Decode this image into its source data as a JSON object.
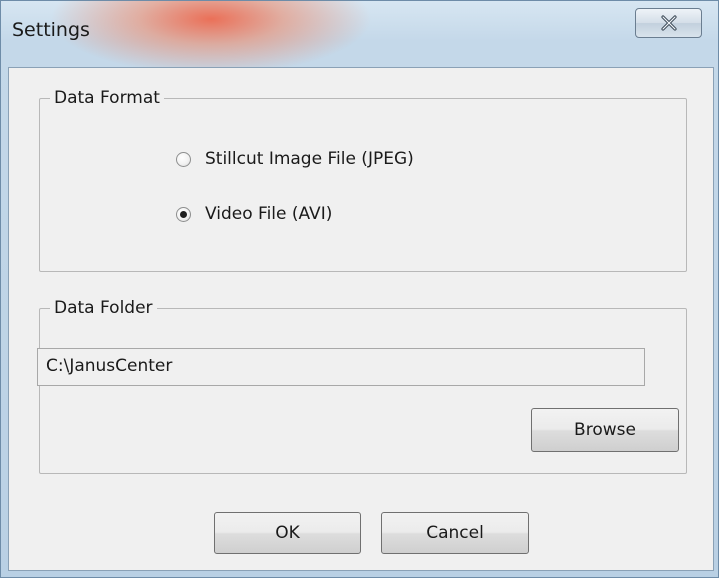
{
  "window": {
    "title": "Settings"
  },
  "data_format": {
    "label": "Data Format",
    "options": [
      {
        "label": "Stillcut Image File (JPEG)",
        "checked": false
      },
      {
        "label": "Video File (AVI)",
        "checked": true
      }
    ]
  },
  "data_folder": {
    "label": "Data Folder",
    "path_value": "C:\\JanusCenter",
    "browse_label": "Browse"
  },
  "footer": {
    "ok_label": "OK",
    "cancel_label": "Cancel"
  },
  "icons": {
    "close": "close-icon"
  }
}
